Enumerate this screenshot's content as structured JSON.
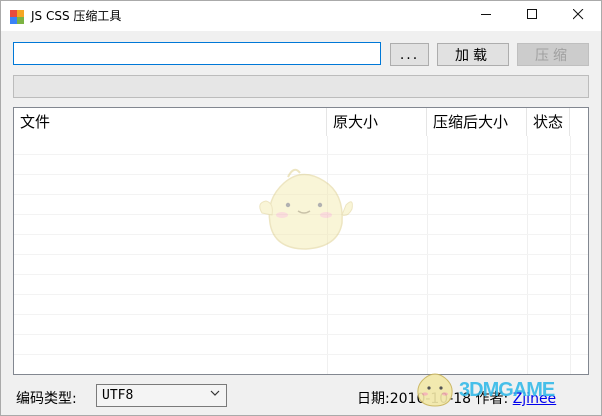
{
  "window": {
    "title": "JS CSS 压缩工具",
    "controls": {
      "minimize": "—",
      "maximize": "☐",
      "close": "✕"
    }
  },
  "toolbar": {
    "path_value": "",
    "browse_label": "...",
    "load_label": "加载",
    "compress_label": "压缩"
  },
  "progress": {
    "value_percent": 0
  },
  "table": {
    "columns": [
      "文件",
      "原大小",
      "压缩后大小",
      "状态"
    ],
    "rows": []
  },
  "status_bar": {
    "encoding_label": "编码类型:",
    "encoding_value": "UTF8",
    "date_label": "日期:2010-10-18",
    "author_label": "作者:",
    "author_name": "Zjinee"
  },
  "watermark": {
    "site": "3DMGAME"
  },
  "colors": {
    "accent": "#0078d7",
    "window_bg": "#f0f0f0",
    "link": "#0000ee"
  }
}
